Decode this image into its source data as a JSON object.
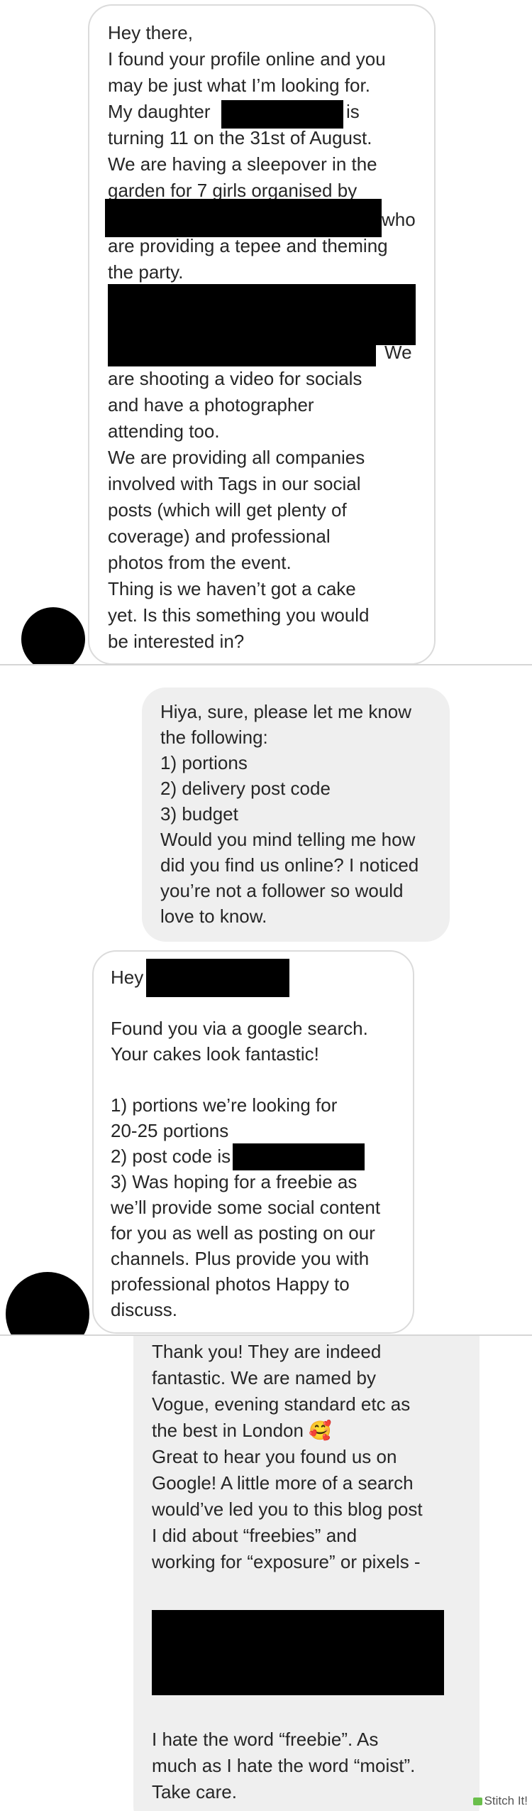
{
  "messages": [
    {
      "id": "m1",
      "sender": "them",
      "lines": [
        "Hey there,",
        "I found your profile online and you",
        "may be just what I’m looking for.",
        "My daughter",
        "is",
        "turning 11 on the 31st of August.",
        "We are having a sleepover in the",
        "garden for 7 girls organised by",
        "who",
        "are providing a tepee and theming",
        "the party.",
        "We",
        "are shooting a video for socials",
        "and have a photographer",
        "attending too.",
        "We are providing all companies",
        "involved with Tags in our social",
        "posts (which will get plenty of",
        "coverage) and professional",
        "photos from the event.",
        "Thing is we haven’t got a cake",
        "yet. Is this something you would",
        "be interested in?"
      ]
    },
    {
      "id": "m2",
      "sender": "me",
      "lines": [
        "Hiya, sure, please let me know",
        "the following:",
        "1) portions",
        "2) delivery post code",
        "3) budget",
        "Would you mind telling me how",
        "did you find us online? I noticed",
        "you’re not a follower so would",
        "love to know."
      ]
    },
    {
      "id": "m3",
      "sender": "them",
      "lines": [
        "Hey",
        "Found you via a google search.",
        "Your cakes look fantastic!",
        "1) portions we’re looking for",
        "20-25 portions",
        "2) post code is",
        "3) Was hoping for a freebie as",
        "we’ll provide some social content",
        "for you as well as posting on our",
        "channels. Plus provide you with",
        "professional photos Happy to",
        "discuss."
      ]
    },
    {
      "id": "m4",
      "sender": "me",
      "lines": [
        "Thank you! They are indeed",
        "fantastic. We are named by",
        "Vogue, evening standard etc as",
        "the best in London 🥰",
        "Great to hear you found us on",
        "Google! A little more of a search",
        "would’ve led you to this blog post",
        "I did about “freebies” and",
        "working for “exposure” or pixels -",
        "I hate the word “freebie”. As",
        "much as I hate the word “moist”.",
        "Take care."
      ]
    }
  ],
  "watermark": "Stitch It!",
  "colors": {
    "incoming_bubble": "#ffffff",
    "incoming_border": "#dbdbdb",
    "outgoing_bubble": "#efefef",
    "text": "#262626",
    "redaction": "#000000"
  }
}
